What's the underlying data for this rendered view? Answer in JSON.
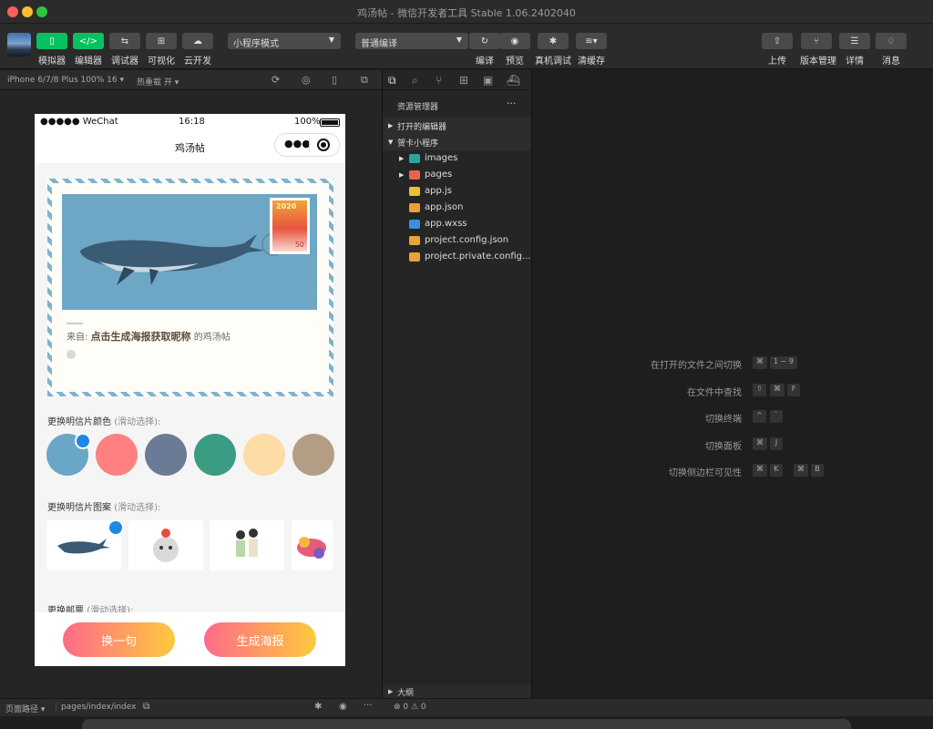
{
  "window": {
    "title": "鸡汤帖 - 微信开发者工具 Stable 1.06.2402040"
  },
  "toolbar": {
    "left_buttons": [
      {
        "label": "模拟器",
        "icon": "phone-icon"
      },
      {
        "label": "编辑器",
        "icon": "code-icon"
      },
      {
        "label": "调试器",
        "icon": "debug-icon"
      },
      {
        "label": "可视化",
        "icon": "layout-icon"
      },
      {
        "label": "云开发",
        "icon": "cloud-icon"
      }
    ],
    "mode_select": "小程序模式",
    "compile_select": "普通编译",
    "mid_buttons": [
      {
        "label": "编译",
        "icon": "refresh-icon"
      },
      {
        "label": "预览",
        "icon": "eye-icon"
      },
      {
        "label": "真机调试",
        "icon": "bug-icon"
      },
      {
        "label": "清缓存",
        "icon": "layers-icon"
      }
    ],
    "right_buttons": [
      {
        "label": "上传",
        "icon": "upload-icon"
      },
      {
        "label": "版本管理",
        "icon": "branch-icon"
      },
      {
        "label": "详情",
        "icon": "menu-icon"
      },
      {
        "label": "消息",
        "icon": "bell-icon"
      }
    ]
  },
  "simulator": {
    "device": "iPhone 6/7/8 Plus 100% 16",
    "hot_reload": "热重载 开",
    "status": {
      "carrier": "●●●●● WeChat",
      "time": "16:18",
      "battery": "100%"
    },
    "nav_title": "鸡汤帖",
    "card": {
      "from_prefix": "来自:",
      "from_name": "点击生成海报获取昵称",
      "from_suffix": "的鸡汤帖",
      "stamp_year": "2020",
      "stamp_value": "50"
    },
    "color_section": {
      "label": "更换明信片颜色",
      "hint": "(滑动选择):"
    },
    "colors": [
      "#6aa7c6",
      "#ff8080",
      "#6b7a95",
      "#3a9c83",
      "#ffdba5",
      "#b39d85"
    ],
    "pattern_section": {
      "label": "更换明信片图案",
      "hint": "(滑动选择):"
    },
    "stamp_section": {
      "label": "更换邮票",
      "hint": "(滑动选择):"
    },
    "btn_change": "换一句",
    "btn_poster": "生成海报"
  },
  "explorer": {
    "title": "资源管理器",
    "more": "···",
    "open_editors": "打开的编辑器",
    "project": "贺卡小程序",
    "files": [
      {
        "name": "images",
        "type": "folder",
        "color": "#27a89a"
      },
      {
        "name": "pages",
        "type": "folder",
        "color": "#e8644b"
      },
      {
        "name": "app.js",
        "type": "js",
        "color": "#e8c22e"
      },
      {
        "name": "app.json",
        "type": "json",
        "color": "#e8a23a"
      },
      {
        "name": "app.wxss",
        "type": "css",
        "color": "#3c8fe0"
      },
      {
        "name": "project.config.json",
        "type": "json",
        "color": "#e8a23a"
      },
      {
        "name": "project.private.config...",
        "type": "json",
        "color": "#e8a23a"
      }
    ],
    "outline": "大纲",
    "errors": "⊗ 0 ⚠ 0"
  },
  "shortcuts": [
    {
      "label": "在打开的文件之间切换",
      "keys": [
        "⌘",
        "1 ~ 9"
      ]
    },
    {
      "label": "在文件中查找",
      "keys": [
        "⇧",
        "⌘",
        "F"
      ]
    },
    {
      "label": "切换终端",
      "keys": [
        "^",
        "`"
      ]
    },
    {
      "label": "切换面板",
      "keys": [
        "⌘",
        "J"
      ]
    },
    {
      "label": "切换侧边栏可见性",
      "keys": [
        "⌘",
        "K",
        "⌘",
        "B"
      ]
    }
  ],
  "status_bar": {
    "path_label": "页面路径",
    "path": "pages/index/index"
  }
}
